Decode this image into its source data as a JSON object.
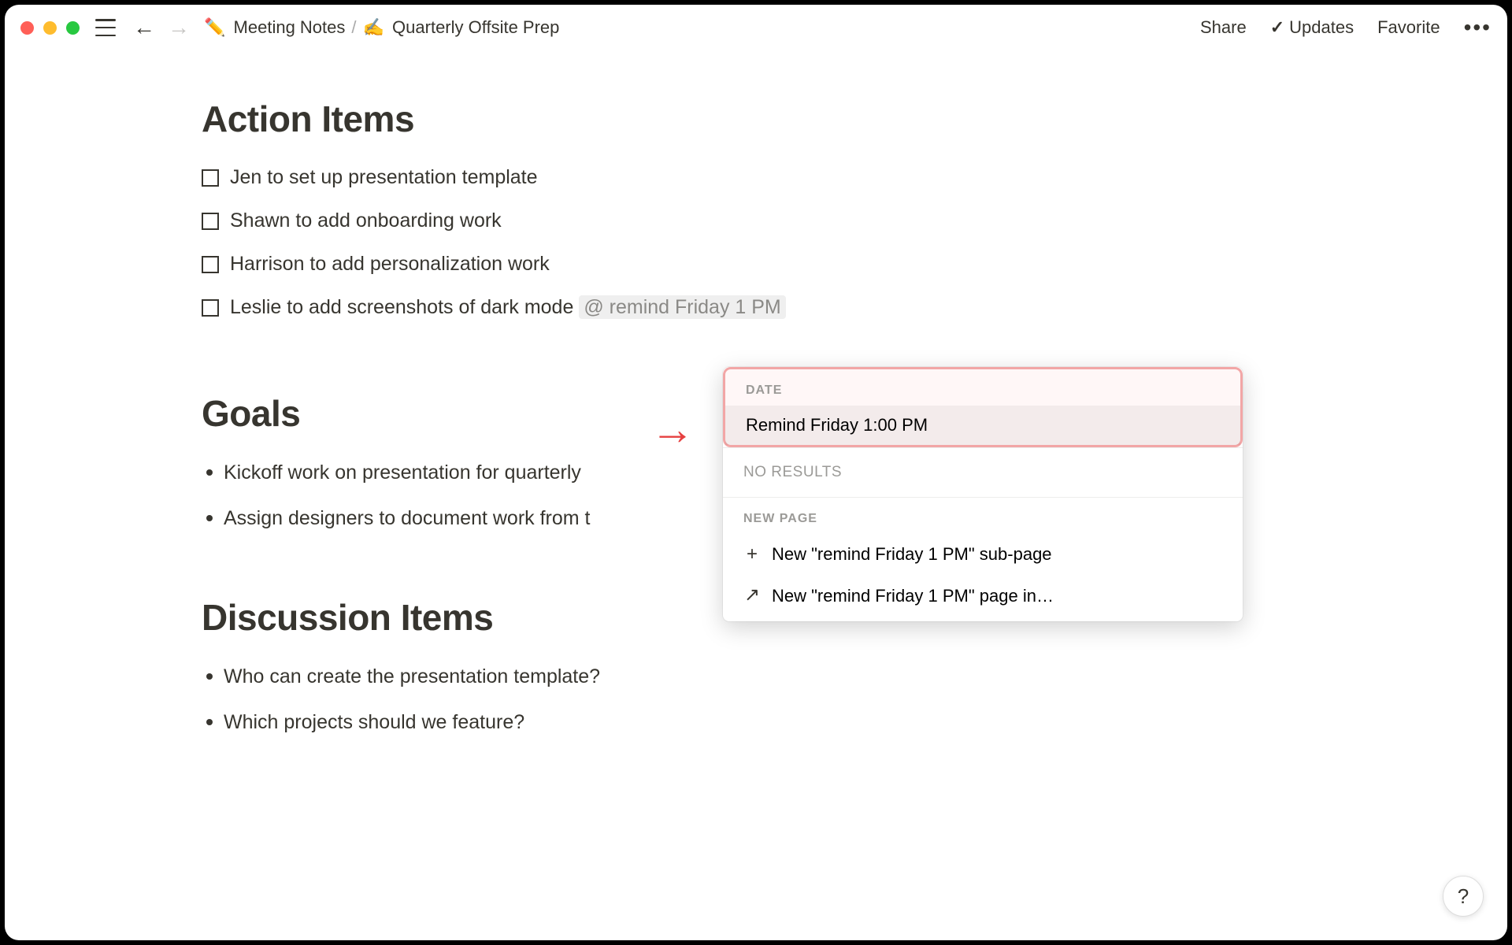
{
  "breadcrumb": {
    "parent_emoji": "✏️",
    "parent_label": "Meeting Notes",
    "page_emoji": "✍️",
    "page_label": "Quarterly Offsite Prep"
  },
  "topbar": {
    "share": "Share",
    "updates": "Updates",
    "favorite": "Favorite"
  },
  "sections": {
    "action_items": "Action Items",
    "goals": "Goals",
    "discussion": "Discussion Items"
  },
  "todos": [
    "Jen to set up presentation template",
    "Shawn to add onboarding work",
    "Harrison to add personalization work"
  ],
  "todo_with_mention": {
    "text": "Leslie to add screenshots of dark mode ",
    "mention": "@ remind Friday 1 PM"
  },
  "goals_list": [
    "Kickoff work on presentation for quarterly",
    "Assign designers to document work from t"
  ],
  "discussion_list": [
    "Who can create the presentation template?",
    "Which projects should we feature?"
  ],
  "popup": {
    "date_label": "DATE",
    "date_option": "Remind Friday 1:00 PM",
    "no_results": "NO RESULTS",
    "new_page_label": "NEW PAGE",
    "sub_page": "New \"remind Friday 1 PM\" sub-page",
    "page_in": "New \"remind Friday 1 PM\" page in…"
  },
  "help": "?"
}
